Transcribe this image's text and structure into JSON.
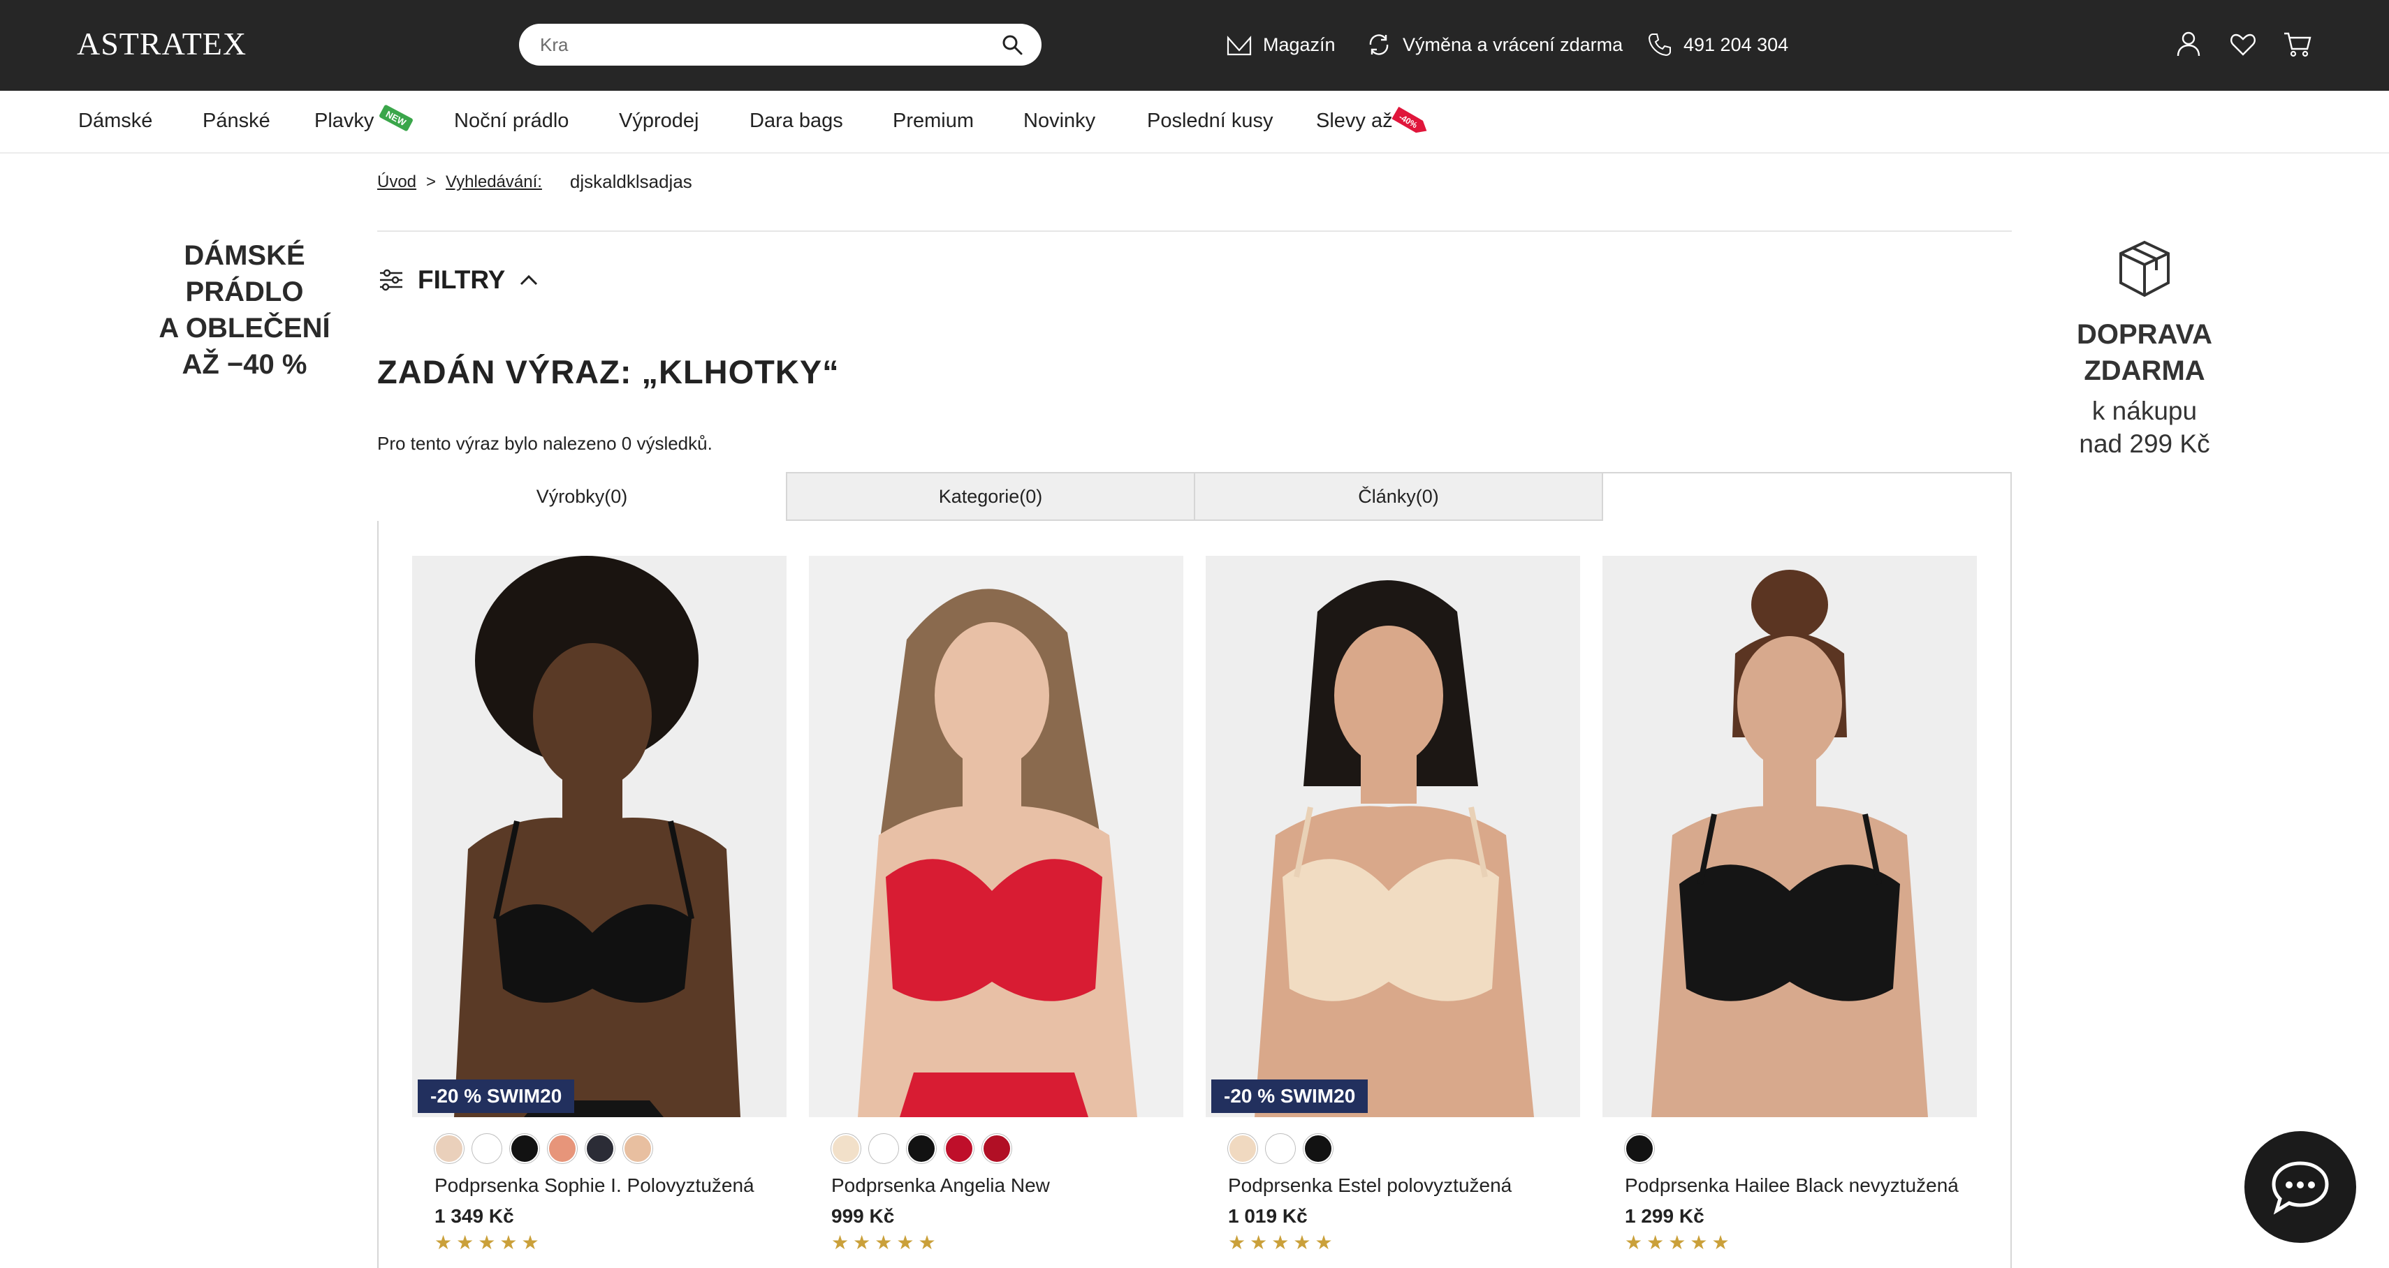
{
  "header": {
    "logo": "ASTRATEX",
    "search": {
      "value": "Kra",
      "placeholder": "Kra"
    },
    "links": [
      {
        "label": "Magazín",
        "icon": "magazine-icon"
      },
      {
        "label": "Výměna a vrácení zdarma",
        "icon": "refresh-icon"
      },
      {
        "label": "491 204 304",
        "icon": "phone-icon"
      }
    ],
    "icons": [
      "account-icon",
      "wishlist-heart-icon",
      "cart-icon"
    ]
  },
  "nav": {
    "items": [
      "Dámské",
      "Pánské",
      "Plavky",
      "Noční prádlo",
      "Výprodej",
      "Dara bags",
      "Premium",
      "Novinky",
      "Poslední kusy",
      "Slevy až"
    ],
    "new_badge": "NEW",
    "sale_badge": "-40%"
  },
  "breadcrumb": {
    "home": "Úvod",
    "separator": ">",
    "search": "Vyhledávání:",
    "current": "djskaldklsadjas"
  },
  "left_banner": {
    "lines": [
      "DÁMSKÉ",
      "PRÁDLO",
      "A OBLEČENÍ",
      "AŽ −40 %"
    ]
  },
  "right_banner": {
    "title1": "DOPRAVA",
    "title2": "ZDARMA",
    "sub1": "k nákupu",
    "sub2": "nad 299 Kč"
  },
  "filters": {
    "label": "FILTRY"
  },
  "results": {
    "title": "ZADÁN VÝRAZ: „KLHOTKY“",
    "count_text": "Pro tento výraz bylo nalezeno 0 výsledků."
  },
  "tabs": [
    {
      "label": "Výrobky(0)",
      "active": true
    },
    {
      "label": "Kategorie(0)",
      "active": false
    },
    {
      "label": "Články(0)",
      "active": false
    }
  ],
  "products": [
    {
      "name": "Podprsenka Sophie I. Polovyztužená",
      "price": "1 349 Kč",
      "promo": "-20 % SWIM20",
      "rating": 5,
      "swatches": [
        "#ead0bb",
        "#ffffff",
        "#121212",
        "#e7957a",
        "#2b2c36",
        "#e8bfa0"
      ],
      "image": "bra-black-model-photo"
    },
    {
      "name": "Podprsenka Angelia New",
      "price": "999 Kč",
      "promo": "",
      "rating": 5,
      "swatches": [
        "#f2e0c9",
        "#ffffff",
        "#121212",
        "#bf0f2a",
        "#b10f25"
      ],
      "image": "bra-red-model-photo"
    },
    {
      "name": "Podprsenka Estel polovyztužená",
      "price": "1 019 Kč",
      "promo": "-20 % SWIM20",
      "rating": 5,
      "swatches": [
        "#f0d9c0",
        "#ffffff",
        "#121212"
      ],
      "image": "bra-beige-model-photo"
    },
    {
      "name": "Podprsenka Hailee Black nevyztužená",
      "price": "1 299 Kč",
      "promo": "",
      "rating": 5,
      "swatches": [
        "#121212"
      ],
      "image": "bra-black-sheer-model-photo"
    }
  ],
  "chat": {
    "icon": "chat-bubble-icon"
  }
}
